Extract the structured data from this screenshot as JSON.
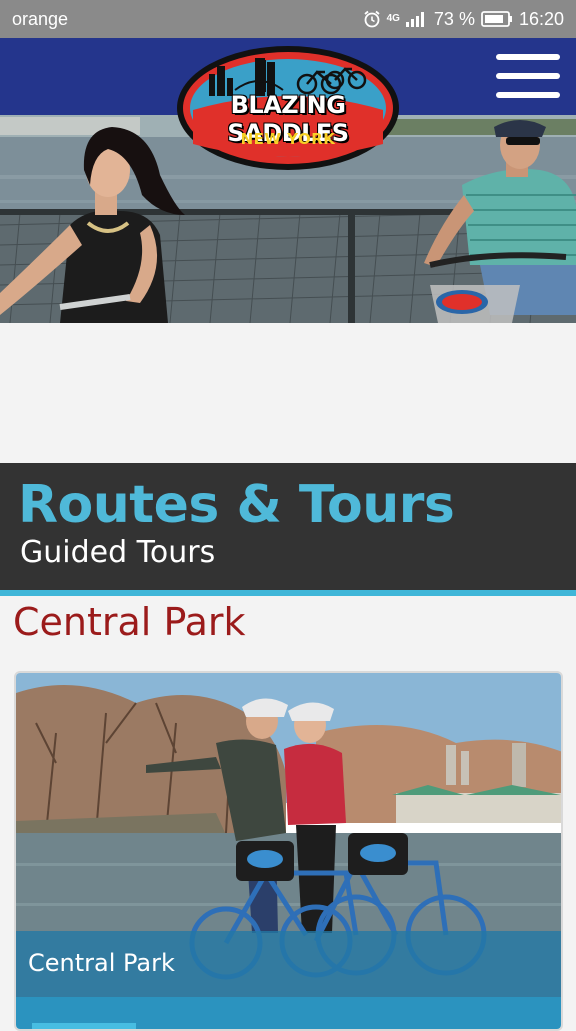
{
  "status_bar": {
    "carrier": "orange",
    "network": "4G",
    "battery": "73 %",
    "time": "16:20",
    "icons": [
      "alarm-icon",
      "signal-icon",
      "battery-icon"
    ]
  },
  "header": {
    "logo_title": "BLAZING SADDLES",
    "logo_subtitle": "NEW YORK",
    "menu_icon": "hamburger-menu-icon",
    "colors": {
      "nav": "#24358c",
      "logo_red": "#e0302a",
      "logo_yellow": "#f7d027"
    }
  },
  "page": {
    "title": "Routes & Tours",
    "subtitle": "Guided Tours",
    "accent": "#3fb6d8",
    "title_color": "#4fb9d9"
  },
  "sections": [
    {
      "heading": "Central Park",
      "heading_color": "#9b1b1b",
      "cards": [
        {
          "caption": "Central Park"
        }
      ]
    }
  ]
}
